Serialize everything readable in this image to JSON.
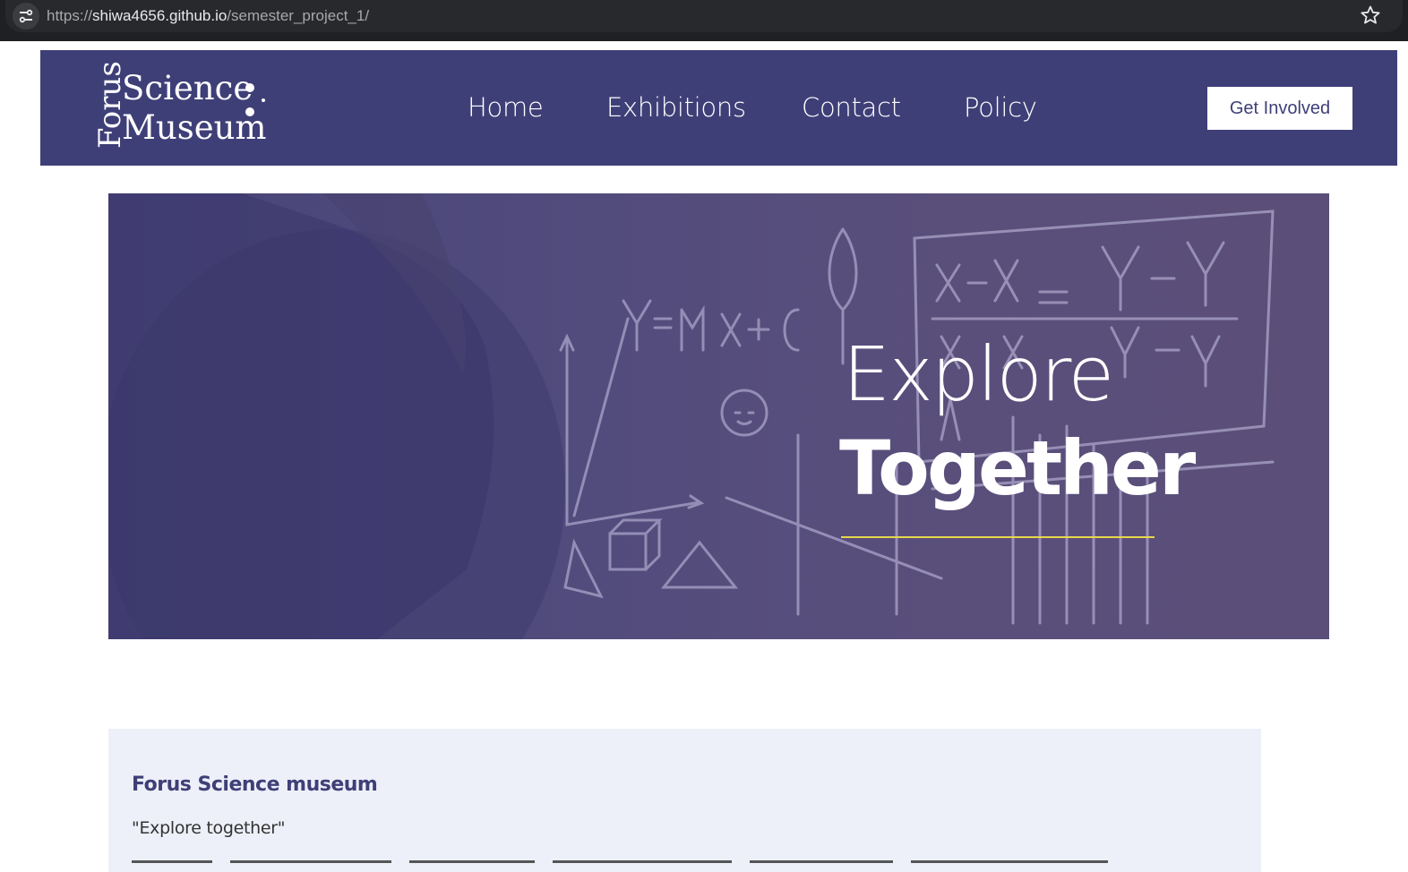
{
  "browser": {
    "url_scheme": "https://",
    "url_host": "shiwa4656.github.io",
    "url_path": "/semester_project_1/",
    "icons": [
      "tune-icon",
      "star-icon"
    ]
  },
  "header": {
    "logo": {
      "line_forus": "Forus",
      "line_science": "Science",
      "line_museum": "Museum"
    },
    "nav": [
      {
        "label": "Home"
      },
      {
        "label": "Exhibitions"
      },
      {
        "label": "Contact"
      },
      {
        "label": "Policy"
      }
    ],
    "cta_label": "Get Involved",
    "colors": {
      "header_bg": "#3f3f78",
      "cta_bg": "#ffffff"
    }
  },
  "hero": {
    "title_light": "Explore",
    "title_bold": "Together",
    "colors": {
      "overlay": "#524c7d",
      "accent_rule": "#e6d84a"
    }
  },
  "intro": {
    "heading": "Forus Science museum",
    "quote": "\"Explore together\""
  }
}
